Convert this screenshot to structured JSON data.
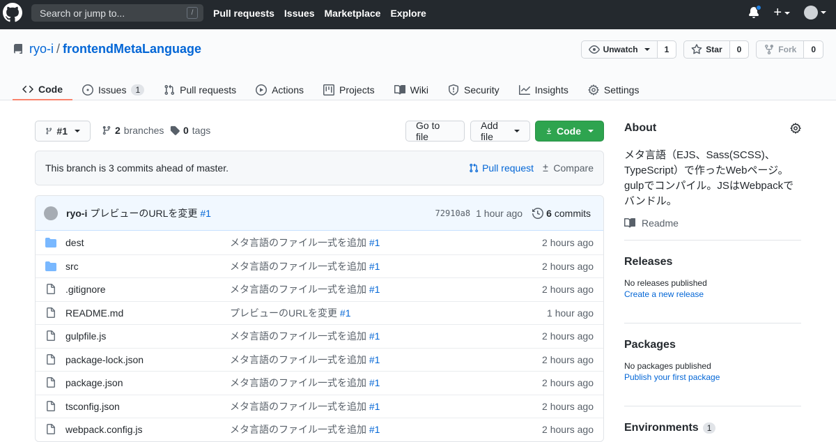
{
  "header": {
    "search_placeholder": "Search or jump to...",
    "search_shortcut": "/",
    "nav": [
      "Pull requests",
      "Issues",
      "Marketplace",
      "Explore"
    ]
  },
  "repo": {
    "owner": "ryo-i",
    "separator": "/",
    "name": "frontendMetaLanguage",
    "watch": {
      "label": "Unwatch",
      "count": "1"
    },
    "star": {
      "label": "Star",
      "count": "0"
    },
    "fork": {
      "label": "Fork",
      "count": "0"
    }
  },
  "tabs": [
    {
      "label": "Code",
      "icon": "code-icon",
      "active": true
    },
    {
      "label": "Issues",
      "icon": "issue-icon",
      "counter": "1"
    },
    {
      "label": "Pull requests",
      "icon": "pull-request-icon"
    },
    {
      "label": "Actions",
      "icon": "play-icon"
    },
    {
      "label": "Projects",
      "icon": "project-icon"
    },
    {
      "label": "Wiki",
      "icon": "book-icon"
    },
    {
      "label": "Security",
      "icon": "shield-icon"
    },
    {
      "label": "Insights",
      "icon": "graph-icon"
    },
    {
      "label": "Settings",
      "icon": "gear-icon"
    }
  ],
  "toolbar": {
    "branch": "#1",
    "branches_count": "2",
    "branches_label": "branches",
    "tags_count": "0",
    "tags_label": "tags",
    "go_to_file": "Go to file",
    "add_file": "Add file",
    "code": "Code"
  },
  "ahead": {
    "text": "This branch is 3 commits ahead of master.",
    "pull_request": "Pull request",
    "compare": "Compare"
  },
  "commit": {
    "author": "ryo-i",
    "message": "プレビューのURLを変更",
    "issue": "#1",
    "sha": "72910a8",
    "time": "1 hour ago",
    "commits_count": "6",
    "commits_label": "commits"
  },
  "files": [
    {
      "name": "dest",
      "type": "dir",
      "message": "メタ言語のファイル一式を追加",
      "issue": "#1",
      "age": "2 hours ago"
    },
    {
      "name": "src",
      "type": "dir",
      "message": "メタ言語のファイル一式を追加",
      "issue": "#1",
      "age": "2 hours ago"
    },
    {
      "name": ".gitignore",
      "type": "file",
      "message": "メタ言語のファイル一式を追加",
      "issue": "#1",
      "age": "2 hours ago"
    },
    {
      "name": "README.md",
      "type": "file",
      "message": "プレビューのURLを変更",
      "issue": "#1",
      "age": "1 hour ago"
    },
    {
      "name": "gulpfile.js",
      "type": "file",
      "message": "メタ言語のファイル一式を追加",
      "issue": "#1",
      "age": "2 hours ago"
    },
    {
      "name": "package-lock.json",
      "type": "file",
      "message": "メタ言語のファイル一式を追加",
      "issue": "#1",
      "age": "2 hours ago"
    },
    {
      "name": "package.json",
      "type": "file",
      "message": "メタ言語のファイル一式を追加",
      "issue": "#1",
      "age": "2 hours ago"
    },
    {
      "name": "tsconfig.json",
      "type": "file",
      "message": "メタ言語のファイル一式を追加",
      "issue": "#1",
      "age": "2 hours ago"
    },
    {
      "name": "webpack.config.js",
      "type": "file",
      "message": "メタ言語のファイル一式を追加",
      "issue": "#1",
      "age": "2 hours ago"
    }
  ],
  "sidebar": {
    "about_title": "About",
    "description": "メタ言語（EJS、Sass(SCSS)、TypeScript）で作ったWebページ。gulpでコンパイル。JSはWebpackでバンドル。",
    "readme": "Readme",
    "releases_title": "Releases",
    "releases_text": "No releases published",
    "releases_link": "Create a new release",
    "packages_title": "Packages",
    "packages_text": "No packages published",
    "packages_link": "Publish your first package",
    "environments_title": "Environments",
    "environments_count": "1"
  },
  "colors": {
    "header_bg": "#24292e",
    "link": "#0366d6",
    "green_button": "#2ea44f",
    "active_tab_border": "#f9826c"
  }
}
